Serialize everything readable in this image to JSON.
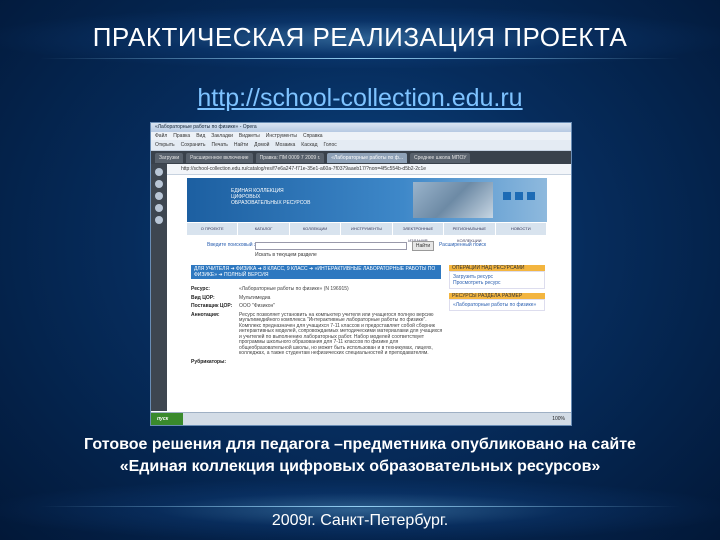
{
  "slide": {
    "title": "ПРАКТИЧЕСКАЯ РЕАЛИЗАЦИЯ ПРОЕКТА",
    "url": "http://school-collection.edu.ru",
    "caption_line1": "Готовое решения для педагога –предметника опубликовано на сайте",
    "caption_line2": "«Единая коллекция цифровых образовательных ресурсов»",
    "footer": "2009г. Санкт-Петербург."
  },
  "browser": {
    "window_title": "«Лабораторные работы по физике» - Opera",
    "menu": [
      "Файл",
      "Правка",
      "Вид",
      "Закладки",
      "Виджеты",
      "Инструменты",
      "Справка"
    ],
    "toolbar": [
      "Открыть",
      "Сохранить",
      "Печать",
      "Найти",
      "Домой",
      "Мозаика",
      "Каскад",
      "Голос"
    ],
    "tabs": [
      "Загрузки",
      "Расширенное включение",
      "Правка: ПМ 0009 7 2009 г.",
      "«Лабораторные работы по ф...",
      "Среднее школа МПОУ"
    ],
    "address": "http://school-collection.edu.ru/catalog/res/f7e6a247-f71e-35e1-a60a-7f0379aaeb17/?non=4f5c554b-d5b2-2c1e",
    "start_label": "пуск",
    "zoom": "100%"
  },
  "site": {
    "logo_line1": "ЕДИНАЯ КОЛЛЕКЦИЯ",
    "logo_line2": "ЦИФРОВЫХ",
    "logo_line3": "ОБРАЗОВАТЕЛЬНЫХ РЕСУРСОВ",
    "nav": [
      "О ПРОЕКТЕ",
      "КАТАЛОГ",
      "КОЛЛЕКЦИИ",
      "ИНСТРУМЕНТЫ",
      "ЭЛЕКТРОННЫЕ ИЗДАНИЯ",
      "РЕГИОНАЛЬНЫЕ КОЛЛЕКЦИИ",
      "НОВОСТИ"
    ],
    "search_label": "Введите поисковый запрос",
    "search_button": "Найти",
    "search_advanced": "Расширенный поиск",
    "search_checkbox": "Искать в текущем разделе",
    "breadcrumbs": "ДЛЯ УЧИТЕЛЯ ➜ ФИЗИКА ➜ 8 КЛАСС, 9 КЛАСС ➜ «ИНТЕРАКТИВНЫЕ ЛАБОРАТОРНЫЕ РАБОТЫ ПО ФИЗИКЕ» ➜ ПОЛНЫЙ ВЕРСИЯ",
    "right_ops_head": "ОПЕРАЦИИ НАД РЕСУРСАМИ",
    "right_ops": [
      "Загрузить ресурс",
      "Просмотреть ресурс"
    ],
    "right_res_head": "РЕСУРСЫ РАЗДЕЛА   РАЗМЕР",
    "right_res_item": "«Лабораторные работы по физике»",
    "rows": [
      {
        "key": "Ресурс:",
        "val": "«Лабораторные работы по физике» (N 196915)"
      },
      {
        "key": "Вид ЦОР:",
        "val": "Мультимедиа"
      },
      {
        "key": "Поставщик ЦОР:",
        "val": "ООО \"Физикон\""
      },
      {
        "key": "Аннотация:",
        "val": "Ресурс позволяет установить на компьютер учителя или учащегося полную версию мультимедийного комплекса \"Интерактивные лабораторные работы по физике\". Комплекс предназначен для учащихся 7-11 классов и предоставляет собой сборник интерактивных моделей, сопровождаемых методическими материалами для учащихся и учителей по выполнению лабораторных работ. Набор моделей соответствует программы школьного образования для 7-11 классов по физике для общеобразовательной школы, но может быть использован и в техникумах, лицеях, колледжах, а также студентам нефизических специальностей и преподавателям."
      },
      {
        "key": "Рубрикаторы:",
        "val": ""
      }
    ]
  }
}
